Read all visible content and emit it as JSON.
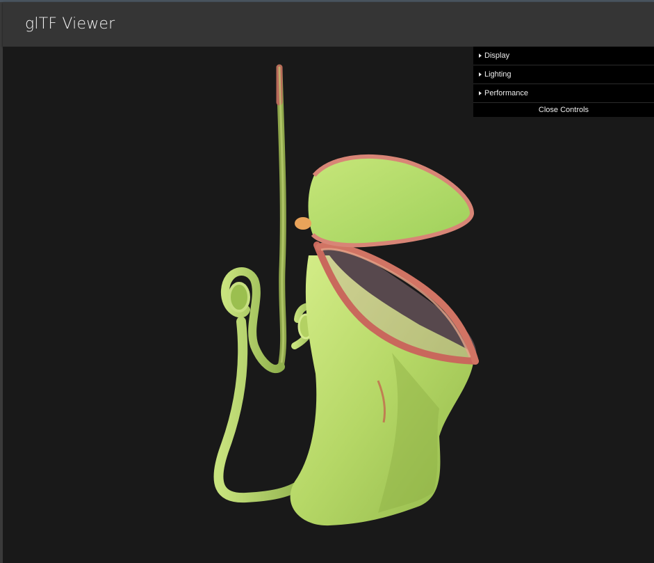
{
  "app": {
    "title": "glTF Viewer"
  },
  "controls": {
    "folders": [
      {
        "label": "Display",
        "icon": "triangle-right-icon"
      },
      {
        "label": "Lighting",
        "icon": "triangle-right-icon"
      },
      {
        "label": "Performance",
        "icon": "triangle-right-icon"
      }
    ],
    "close_label": "Close Controls"
  },
  "colors": {
    "header_bg": "#353535",
    "viewport_bg": "#191919",
    "panel_bg": "#000000",
    "model_green": "#b9dc6a",
    "model_rim": "#c96a5e"
  }
}
